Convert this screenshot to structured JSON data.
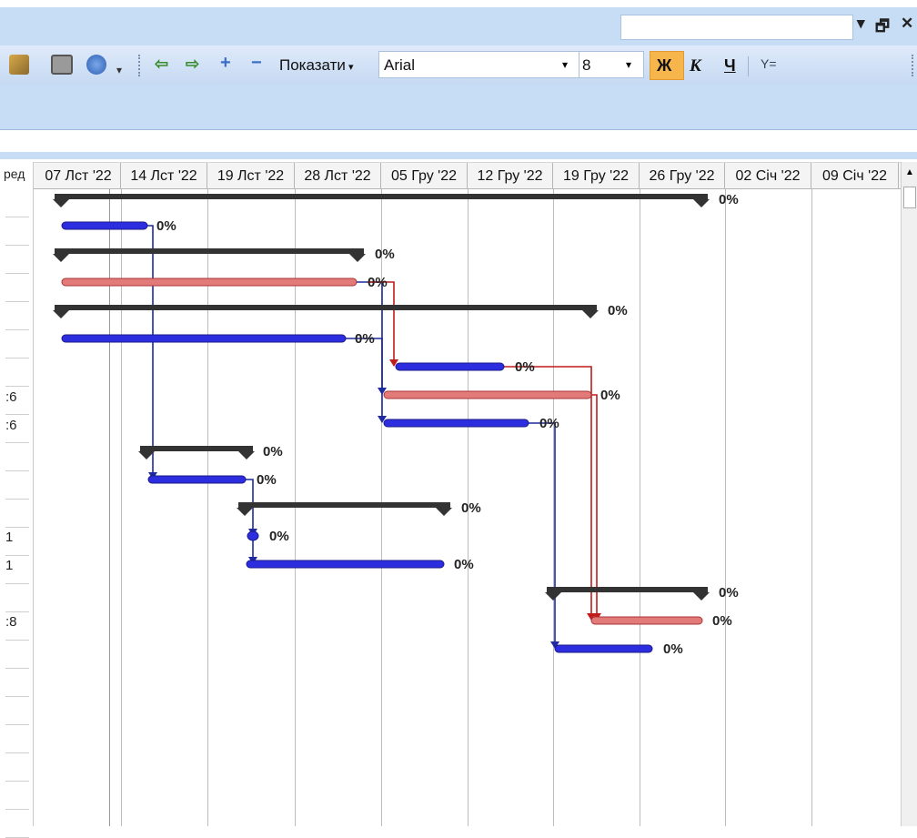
{
  "toolbar": {
    "show_menu_label": "Показати",
    "font_name": "Arial",
    "font_size": "8",
    "bold_label": "Ж",
    "italic_label": "К",
    "underline_label": "Ч",
    "filter_label": "Y="
  },
  "window_buttons": {
    "restore": "🗗",
    "close": "✕"
  },
  "left_column": {
    "header_fragment": "ред",
    "row_fragments": [
      ":6",
      ":6",
      "1",
      "1",
      ":8"
    ]
  },
  "timescale": [
    "07 Лст '22",
    "14 Лст '22",
    "19 Лст '22",
    "28 Лст '22",
    "05 Гру '22",
    "12 Гру '22",
    "19 Гру '22",
    "26 Гру '22",
    "02 Січ '22",
    "09 Січ '22"
  ],
  "colors": {
    "summary": "#333333",
    "task": "#2d2de0",
    "critical": "#e27a7a",
    "critical_link": "#c21b1b",
    "task_link": "#1f2aa0",
    "bold_btn": "#f7b64c"
  },
  "tasks": [
    {
      "kind": "summary",
      "progress_label": "0%"
    },
    {
      "kind": "task",
      "progress_label": "0%"
    },
    {
      "kind": "summary",
      "progress_label": "0%"
    },
    {
      "kind": "critical",
      "progress_label": "0%"
    },
    {
      "kind": "summary",
      "progress_label": "0%"
    },
    {
      "kind": "task",
      "progress_label": "0%"
    },
    {
      "kind": "task",
      "progress_label": "0%"
    },
    {
      "kind": "critical",
      "progress_label": "0%"
    },
    {
      "kind": "task",
      "progress_label": "0%"
    },
    {
      "kind": "summary",
      "progress_label": "0%"
    },
    {
      "kind": "task",
      "progress_label": "0%"
    },
    {
      "kind": "summary",
      "progress_label": "0%"
    },
    {
      "kind": "milestone",
      "progress_label": "0%"
    },
    {
      "kind": "task",
      "progress_label": "0%"
    },
    {
      "kind": "summary",
      "progress_label": "0%"
    },
    {
      "kind": "critical",
      "progress_label": "0%"
    },
    {
      "kind": "task",
      "progress_label": "0%"
    }
  ]
}
